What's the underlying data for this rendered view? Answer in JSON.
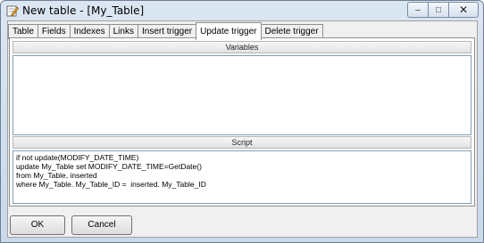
{
  "window": {
    "title": "New table - [My_Table]",
    "minimize_glyph": "–",
    "maximize_glyph": "□",
    "close_glyph": "✕"
  },
  "tabs": [
    {
      "label": "Table",
      "active": false
    },
    {
      "label": "Fields",
      "active": false
    },
    {
      "label": "Indexes",
      "active": false
    },
    {
      "label": "Links",
      "active": false
    },
    {
      "label": "Insert trigger",
      "active": false
    },
    {
      "label": "Update trigger",
      "active": true
    },
    {
      "label": "Delete trigger",
      "active": false
    }
  ],
  "variables": {
    "header": "Variables",
    "value": ""
  },
  "script": {
    "header": "Script",
    "value": "if not update(MODIFY_DATE_TIME)\nupdate My_Table set MODIFY_DATE_TIME=GetDate()\nfrom My_Table, inserted\nwhere My_Table. My_Table_ID =  inserted. My_Table_ID"
  },
  "buttons": {
    "ok": "OK",
    "cancel": "Cancel"
  }
}
